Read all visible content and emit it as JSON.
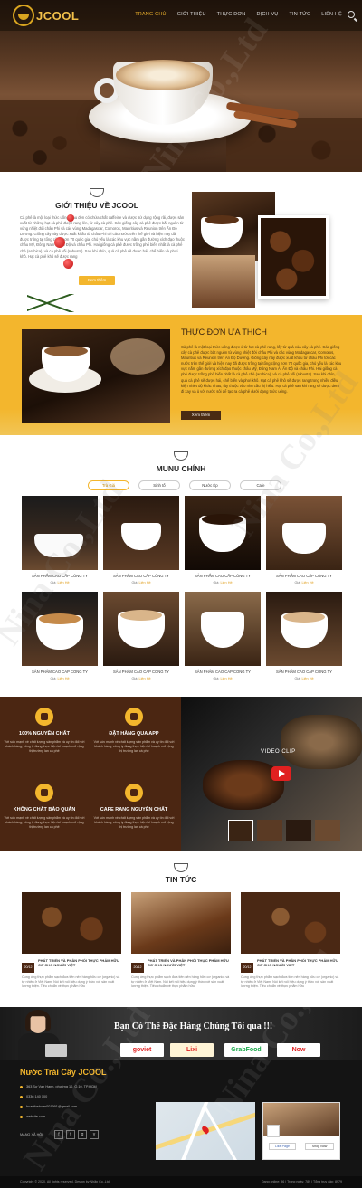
{
  "header": {
    "logo": "JCOOL",
    "nav": [
      "TRANG CHỦ",
      "GIỚI THIỆU",
      "THỰC ĐƠN",
      "DỊCH VỤ",
      "TIN TỨC",
      "LIÊN HỆ"
    ],
    "active_index": 0
  },
  "about": {
    "title": "GIỚI THIỆU VỀ JCOOL",
    "text": "Cà phê là một loại thức uống màu đen có chứa chất caffeine và được sử dụng rộng rãi, được sản xuất từ những hạt cà phê được rang lên, từ cây cà phê. Các giống cây cà phê được bắt nguồn từ vùng nhiệt đới châu Phi và các vùng Madagascar, Comoros, Mauritius và Réunion trên Ấn Độ Dương. Giống cây này được xuất khẩu từ châu Phi tới các nước trên thế giới và hiện nay đã được trồng tại tổng cộng hơn 70 quốc gia, chủ yếu là các khu vực nằm gần đường xích đạo thuộc châu Mỹ, Đông Nam Á, Ấn Độ và châu Phi. Hai giống cà phê được trồng phổ biến nhất là cà phê chè (arabica), và cà phê vối (robusta). Sau khi chín, quả cà phê sẽ được hái, chế biến và phơi khô. Hạt cà phê khô sẽ được rang",
    "button": "Xem thêm"
  },
  "favorite": {
    "title": "THỰC ĐƠN ƯA THÍCH",
    "text": "Cà phê là một loại thức uống được ủ từ hạt cà phê rang, lấy từ quả của cây cà phê. Các giống cây cà phê được bắt nguồn từ vùng nhiệt đới châu Phi và các vùng Madagascar, Comoros, Mauritius và Réunion trên Ấn Độ Dương. Giống cây này được xuất khẩu từ châu Phi tới các nước trên thế giới và hiện nay đã được trồng tại tổng cộng hơn 70 quốc gia, chủ yếu là các khu vực nằm gần đường xích đạo thuộc châu Mỹ, Đông Nam Á, Ấn Độ và châu Phi. Hai giống cà phê được trồng phổ biến nhất là cà phê chè (arabica), và cà phê vối (robusta). Sau khi chín, quả cà phê sẽ được hái, chế biến và phơi khô. Hạt cà phê khô sẽ được rang trong nhiều điều kiện nhiệt độ khác nhau, tùy thuộc vào nhu cầu thị hiếu. Hạt cà phê sau khi rang sẽ được đem đi xay và ủ với nước sôi để tạo ra cà phê dưới dạng thức uống.",
    "button": "Xem thêm"
  },
  "main_menu": {
    "title": "MUNU CHÍNH",
    "tabs": [
      "Trà Giá",
      "Sinh tố",
      "Nước Ép",
      "Cafe"
    ],
    "active_tab": 0,
    "products": [
      {
        "name": "SẢN PHẨM CAO CẤP CÔNG TY",
        "price_label": "Giá:",
        "price": "Liên Hệ"
      },
      {
        "name": "SẢN PHẨM CAO CẤP CÔNG TY",
        "price_label": "Giá:",
        "price": "Liên Hệ"
      },
      {
        "name": "SẢN PHẨM CAO CẤP CÔNG TY",
        "price_label": "Giá:",
        "price": "Liên Hệ"
      },
      {
        "name": "SẢN PHẨM CAO CẤP CÔNG TY",
        "price_label": "Giá:",
        "price": "Liên Hệ"
      },
      {
        "name": "SẢN PHẨM CAO CẤP CÔNG TY",
        "price_label": "Giá:",
        "price": "Liên Hệ"
      },
      {
        "name": "SẢN PHẨM CAO CẤP CÔNG TY",
        "price_label": "Giá:",
        "price": "Liên Hệ"
      },
      {
        "name": "SẢN PHẨM CAO CẤP CÔNG TY",
        "price_label": "Giá:",
        "price": "Liên Hệ"
      },
      {
        "name": "SẢN PHẨM CAO CẤP CÔNG TY",
        "price_label": "Giá:",
        "price": "Liên Hệ"
      }
    ]
  },
  "features": {
    "items": [
      {
        "title": "100% NGUYÊN CHẤT",
        "text": "Với sức mạnh về chất lượng sản phẩm và uy tín đối với khách hàng, công ty đang thực hiện kế hoạch mở rộng thị trường lan cà phê"
      },
      {
        "title": "ĐẶT HÀNG QUA APP",
        "text": "Với sức mạnh về chất lượng sản phẩm và uy tín đối với khách hàng, công ty đang thực hiện kế hoạch mở rộng thị trường lan cà phê"
      },
      {
        "title": "KHÔNG CHẤT BẢO QUẢN",
        "text": "Với sức mạnh về chất lượng sản phẩm và uy tín đối với khách hàng, công ty đang thực hiện kế hoạch mở rộng thị trường lan cà phê"
      },
      {
        "title": "CAFE RANG NGUYÊN CHẤT",
        "text": "Với sức mạnh về chất lượng sản phẩm và uy tín đối với khách hàng, công ty đang thực hiện kế hoạch mở rộng thị trường lan cà phê"
      }
    ],
    "video_label": "VIDEO CLIP"
  },
  "news": {
    "title": "TIN TỨC",
    "items": [
      {
        "date": "20/12",
        "title": "PHÁT TRIỂN VÀ PHÂN PHỐI THỰC PHẨM HỮU CƠ CHO NGƯỜI VIỆT",
        "text": "Cung ứng thực phẩm sạch đưa tiên nên hàng hữu cơ (organic) và tự nhiên ở Việt Nam. Nói kết nối hiệu dụng ý thức với sản xuất lương thiện. Tiêu chuẩn về thực phẩm hữu"
      },
      {
        "date": "20/12",
        "title": "PHÁT TRIỂN VÀ PHÂN PHỐI THỰC PHẨM HỮU CƠ CHO NGƯỜI VIỆT",
        "text": "Cung ứng thực phẩm sạch đưa tiên nên hàng hữu cơ (organic) và tự nhiên ở Việt Nam. Nói kết nối hiệu dụng ý thức với sản xuất lương thiện. Tiêu chuẩn về thực phẩm hữu"
      },
      {
        "date": "20/12",
        "title": "PHÁT TRIỂN VÀ PHÂN PHỐI THỰC PHẨM HỮU CƠ CHO NGƯỜI VIỆT",
        "text": "Cung ứng thực phẩm sạch đưa tiên nên hàng hữu cơ (organic) và tự nhiên ở Việt Nam. Nói kết nối hiệu dụng ý thức với sản xuất lương thiện. Tiêu chuẩn về thực phẩm hữu"
      }
    ]
  },
  "order": {
    "title": "Bạn Có Thể Đặc Hàng Chúng Tôi qua !!!",
    "partners": [
      {
        "name": "goviet",
        "color": "#e02020"
      },
      {
        "name": "Lixi",
        "color": "#e02020"
      },
      {
        "name": "GrabFood",
        "color": "#1aa84a"
      },
      {
        "name": "Now",
        "color": "#e02020"
      }
    ]
  },
  "footer": {
    "title": "Nước Trái Cây JCOOL",
    "address": "363 Sư Vạn Hạnh, phường 10, Q.10, TP.HCM",
    "phone": "0336 140 100",
    "email": "huanthehuan001991@gmail.com",
    "website": "website.com",
    "social_label": "MẠNG XÃ HỘI:",
    "social": [
      "f",
      "t",
      "g",
      "y"
    ],
    "fb_like": "Like Page",
    "fb_shop": "Shop Now",
    "copyright": "Copyright © 2020, All rights reserved. Design by Nhãp Co.,Ltd",
    "stats": "Đang online: 96  |  Trong ngày: 789  |  Tổng truy cập: 8979"
  },
  "watermark": "Nina Co.,Ltd"
}
